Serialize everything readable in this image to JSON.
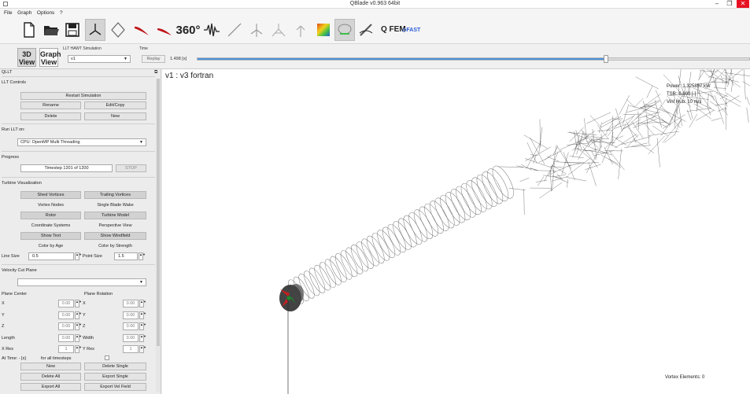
{
  "window": {
    "title": "QBlade v0.963 64bit",
    "min": "–",
    "max": "❐",
    "close": "✕"
  },
  "menu": [
    "File",
    "Graph",
    "Options",
    "?"
  ],
  "toolbar": {
    "deg360": "360°",
    "qfem": "Q FEM",
    "qfast": "◇FAST"
  },
  "subbar": {
    "view3d": "3D View",
    "viewGraph": "Graph View",
    "sim_label": "LLT HAWT Simulation",
    "sim_value": "v1",
    "time_label": "Time",
    "replay": "Replay",
    "time_value": "1.498 [s]",
    "progress_fraction": 0.74
  },
  "panel": {
    "title": "QLLT",
    "controls_header": "LLT Controls",
    "restart": "Restart Simulation",
    "rename": "Rename",
    "edit_copy": "Edit/Copy",
    "delete": "Delete",
    "new": "New",
    "run_on": "Run LLT on:",
    "run_device": "CPU: OpenMP Multi Threading",
    "progress": "Progress",
    "timestep": "Timestep 1201 of 1200",
    "stop": "STOP",
    "turbine_vis": "Turbine Visualization",
    "shed": "Shed Vortices",
    "trailing": "Trailing Vortices",
    "vortex_nodes": "Vortex Nodes",
    "single_blade": "Single Blade Wake",
    "rotor": "Rotor",
    "turbine_model": "Turbine Model",
    "coord": "Coordinate Systems",
    "perspective": "Perspective View",
    "show_text": "Show Text",
    "show_wind": "Show Windfield",
    "color_age": "Color by Age",
    "color_strength": "Color by Strength",
    "line_size_label": "Line Size",
    "line_size": "0.5",
    "point_size_label": "Point Size",
    "point_size": "1.5",
    "velocity_cut": "Velocity Cut Plane",
    "plane_center": "Plane Center",
    "plane_rotation": "Plane Rotation",
    "x": "X",
    "y": "Y",
    "z": "Z",
    "zero": "0.00",
    "length": "Length",
    "width": "Width",
    "xres": "X Res",
    "yres": "Y Res",
    "one": "1",
    "at_time": "At Time: - [s]",
    "for_all": "for all timesteps",
    "btn_new": "New",
    "delete_single": "Delete Single",
    "delete_all": "Delete All",
    "export_single": "Export Single",
    "export_all": "Export All",
    "export_vel": "Export Vel Field"
  },
  "viewport": {
    "caption": "v1 : v3 fortran",
    "legend": [
      "Power: 1.325857 kW",
      "TSR: 6.000 [-]",
      "Vinf Hub: 10 m/s"
    ],
    "vortex": "Vortex Elements: 0"
  },
  "colors": {
    "accent": "#4a90d9",
    "close": "#e81123"
  }
}
